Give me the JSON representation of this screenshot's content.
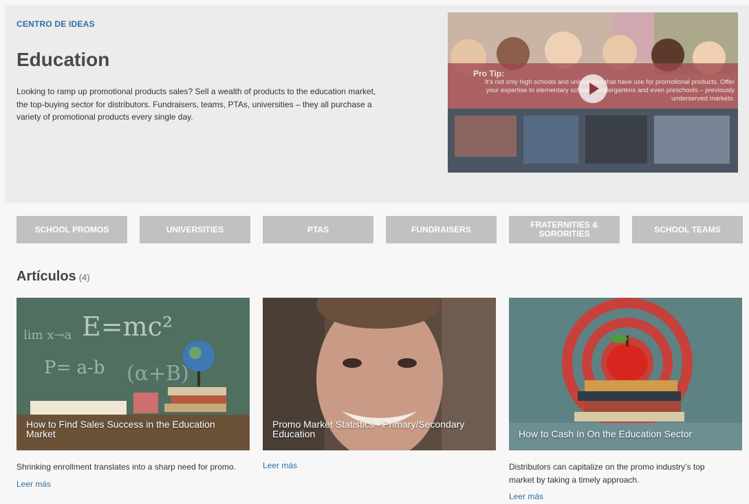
{
  "hero": {
    "eyebrow": "CENTRO DE IDEAS",
    "title": "Education",
    "description": "Looking to ramp up promotional products sales? Sell a wealth of products to the education market, the top-buying sector for distributors. Fundraisers, teams, PTAs, universities – they all purchase a variety of promotional products every single day.",
    "video": {
      "tip_title": "Pro Tip:",
      "tip_text": "It’s not only high schools and universities that have use for promotional products. Offer your expertise to elementary schools, kindergartens and even preschools – previously underserved markets.",
      "play_icon": "play-icon"
    }
  },
  "tabs": [
    {
      "label": "SCHOOL PROMOS"
    },
    {
      "label": "UNIVERSITIES"
    },
    {
      "label": "PTAS"
    },
    {
      "label": "FUNDRAISERS"
    },
    {
      "label": "FRATERNITIES & SORORITIES"
    },
    {
      "label": "SCHOOL TEAMS"
    }
  ],
  "articles": {
    "title": "Artículos",
    "count": "(4)",
    "items": [
      {
        "caption": "How to Find Sales Success in the Education Market",
        "description": "Shrinking enrollment translates into a sharp need for promo.",
        "link": "Leer más"
      },
      {
        "caption": "Promo Market Statistics - Primary/Secondary Education",
        "description": "",
        "link": "Leer más"
      },
      {
        "caption": "How to Cash In On the Education Sector",
        "description": "Distributors can capitalize on the promo industry’s top market by taking a timely approach.",
        "link": "Leer más"
      }
    ]
  },
  "colors": {
    "accent": "#2d6fa6",
    "tab_bg": "#c1c1c1",
    "hero_bg": "#ececec",
    "tip_band": "#a0464b"
  }
}
